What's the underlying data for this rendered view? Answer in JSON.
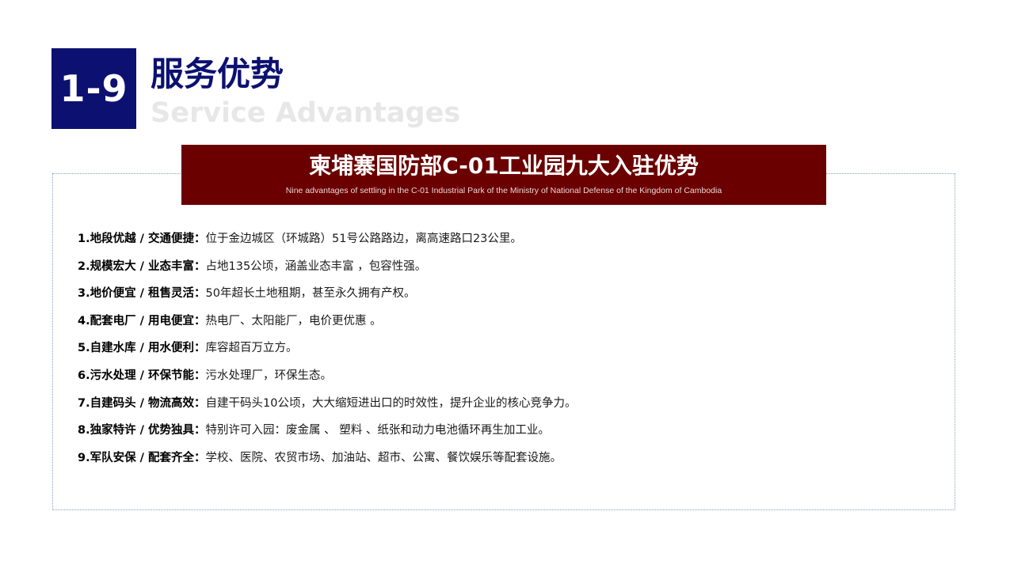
{
  "header": {
    "badge": "1-9",
    "title_cn": "服务优势",
    "title_en": "Service Advantages"
  },
  "banner": {
    "title": "柬埔寨国防部C-01工业园九大入驻优势",
    "subtitle": "Nine advantages of settling in the C-01 Industrial Park of the Ministry of National Defense of the Kingdom of Cambodia"
  },
  "advantages": [
    {
      "label": "1.地段优越 / 交通便捷：",
      "text": "位于金边城区（环城路）51号公路路边，离高速路口23公里。"
    },
    {
      "label": "2.规模宏大 / 业态丰富：",
      "text": "占地135公顷，涵盖业态丰富 ，包容性强。"
    },
    {
      "label": "3.地价便宜 / 租售灵活：",
      "text": "50年超长土地租期，甚至永久拥有产权。"
    },
    {
      "label": "4.配套电厂 / 用电便宜：",
      "text": "热电厂、太阳能厂，电价更优惠 。"
    },
    {
      "label": "5.自建水库 / 用水便利：",
      "text": "库容超百万立方。"
    },
    {
      "label": "6.污水处理 / 环保节能：",
      "text": "污水处理厂，环保生态。"
    },
    {
      "label": "7.自建码头 / 物流高效：",
      "text": "自建干码头10公顷，大大缩短进出口的时效性，提升企业的核心竞争力。"
    },
    {
      "label": "8.独家特许 / 优势独具：",
      "text": "特别许可入园：废金属 、 塑料 、纸张和动力电池循环再生加工业。"
    },
    {
      "label": "9.军队安保 / 配套齐全：",
      "text": "学校、医院、农贸市场、加油站、超市、公寓、餐饮娱乐等配套设施。"
    }
  ],
  "colors": {
    "navy": "#0c1171",
    "banner_red": "#6b0000",
    "watermark_gray": "#e7e7e7"
  }
}
